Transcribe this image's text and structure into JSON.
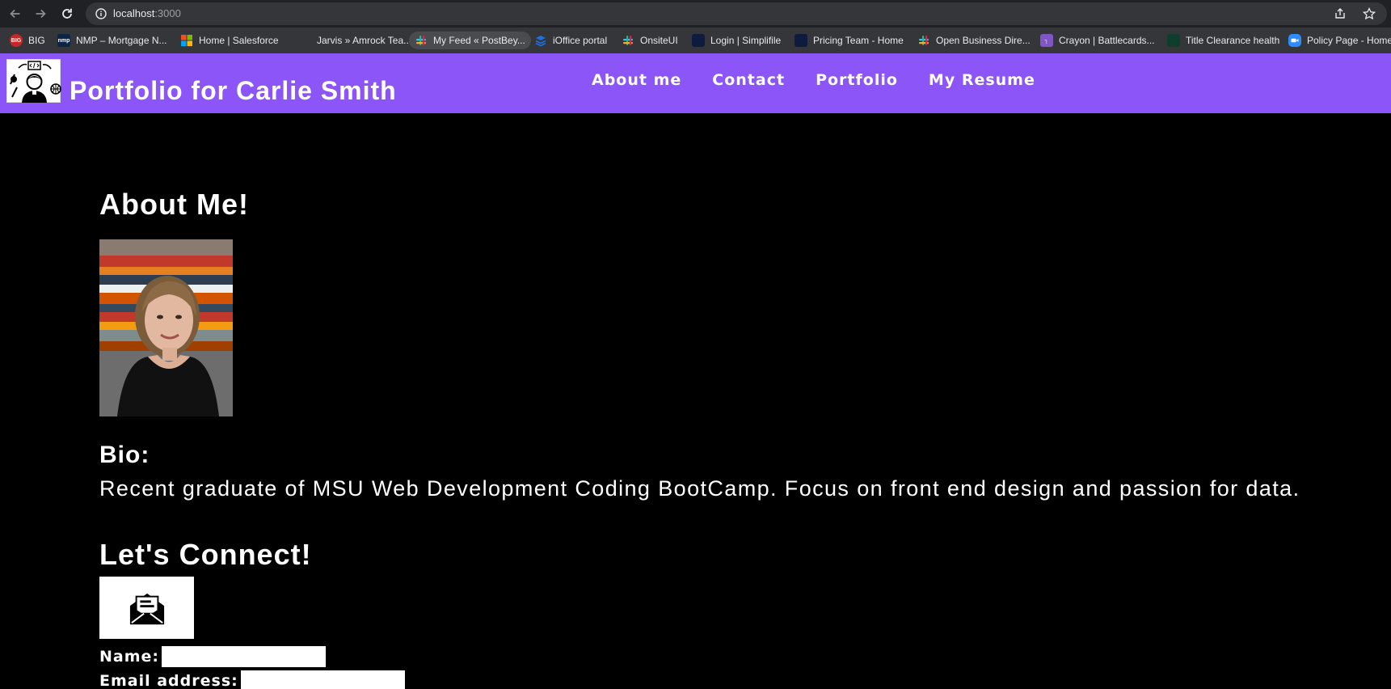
{
  "browser": {
    "url_host": "localhost",
    "url_port": ":3000",
    "bookmarks": [
      {
        "label": "BIG",
        "icon": "big-icon",
        "color": "#c62828",
        "glyph": "BIG"
      },
      {
        "label": "NMP – Mortgage N...",
        "icon": "nmp-icon",
        "color": "#0b2545",
        "glyph": "nmp"
      },
      {
        "label": "Home | Salesforce",
        "icon": "microsoft-icon",
        "color": "",
        "glyph": ""
      },
      {
        "label": "Jarvis » Amrock Tea...",
        "icon": "",
        "color": "",
        "glyph": ""
      },
      {
        "label": "My Feed « PostBey...",
        "icon": "slack-icon",
        "color": "",
        "glyph": ""
      },
      {
        "label": "iOffice portal",
        "icon": "ioffice-icon",
        "color": "#1e6fe0",
        "glyph": ""
      },
      {
        "label": "OnsiteUI",
        "icon": "slack-icon",
        "color": "",
        "glyph": ""
      },
      {
        "label": "Login | Simplifile",
        "icon": "simplifile-icon",
        "color": "#0d1b3e",
        "glyph": ""
      },
      {
        "label": "Pricing Team - Home",
        "icon": "rocket-icon",
        "color": "#0d1b3e",
        "glyph": ""
      },
      {
        "label": "Open Business Dire...",
        "icon": "slack-icon",
        "color": "",
        "glyph": ""
      },
      {
        "label": "Crayon | Battlecards...",
        "icon": "crayon-icon",
        "color": "#7e57c2",
        "glyph": "┐"
      },
      {
        "label": "Title Clearance health",
        "icon": "clearance-icon",
        "color": "#0f3d2e",
        "glyph": ""
      },
      {
        "label": "Policy Page - Home",
        "icon": "zoom-icon",
        "color": "#2d8cff",
        "glyph": ""
      }
    ]
  },
  "header": {
    "title": "Portfolio for Carlie Smith",
    "nav": [
      "About me",
      "Contact",
      "Portfolio",
      "My Resume"
    ],
    "color": "#8c55f8"
  },
  "about": {
    "heading": "About Me!",
    "bio_heading": "Bio:",
    "bio_text": "Recent graduate of MSU Web Development Coding BootCamp. Focus on front end design and passion for data."
  },
  "connect": {
    "heading": "Let's Connect!",
    "name_label": "Name:",
    "name_value": "",
    "email_label": "Email address:",
    "email_value": ""
  }
}
